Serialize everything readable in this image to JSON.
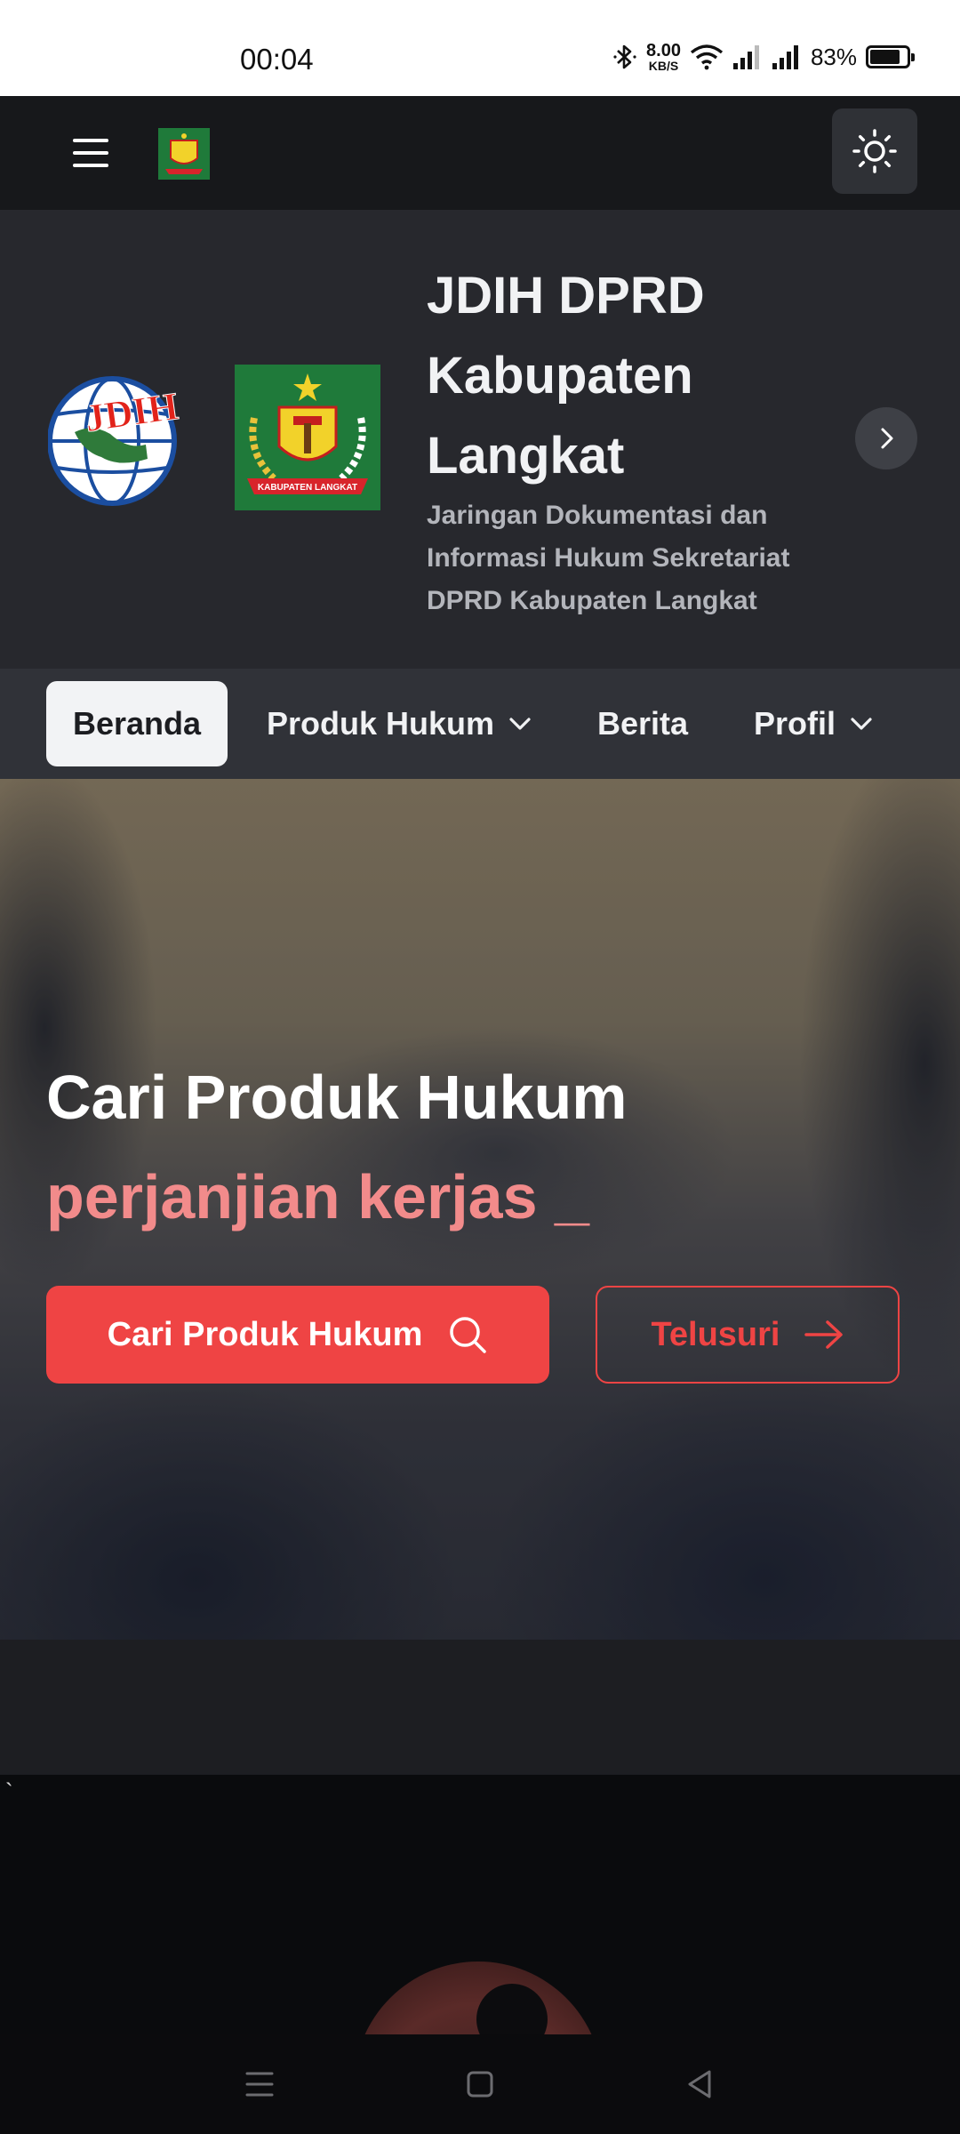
{
  "status_bar": {
    "time": "00:04",
    "net_speed_value": "8.00",
    "net_speed_unit": "KB/S",
    "battery_percent": "83%",
    "battery_level": 0.83
  },
  "topbar": {
    "menu_icon": "hamburger-menu-icon",
    "emblem": "kabupaten-langkat-emblem",
    "theme_icon": "sun-icon"
  },
  "header": {
    "title": "JDIH DPRD Kabupaten Langkat",
    "subtitle": "Jaringan Dokumentasi dan Informasi Hukum Sekretariat DPRD Kabupaten Langkat",
    "jdih_logo_text": "JDIH",
    "emblem_banner_text": "KABUPATEN LANGKAT",
    "next_icon": "chevron-right-icon"
  },
  "nav": {
    "items": [
      {
        "label": "Beranda",
        "active": true
      },
      {
        "label": "Produk Hukum",
        "dropdown": true
      },
      {
        "label": "Berita"
      },
      {
        "label": "Profil",
        "dropdown": true
      }
    ]
  },
  "hero": {
    "title": "Cari Produk Hukum",
    "typed_text": "perjanjian kerjas _",
    "search_button_label": "Cari Produk Hukum",
    "browse_button_label": "Telusuri"
  },
  "footer_fragment": {
    "backtick": "`"
  },
  "colors": {
    "accent": "#ef4444",
    "typed_text": "#f28b8b",
    "topbar": "#17181b",
    "header": "#27282d",
    "nav": "#303238"
  }
}
